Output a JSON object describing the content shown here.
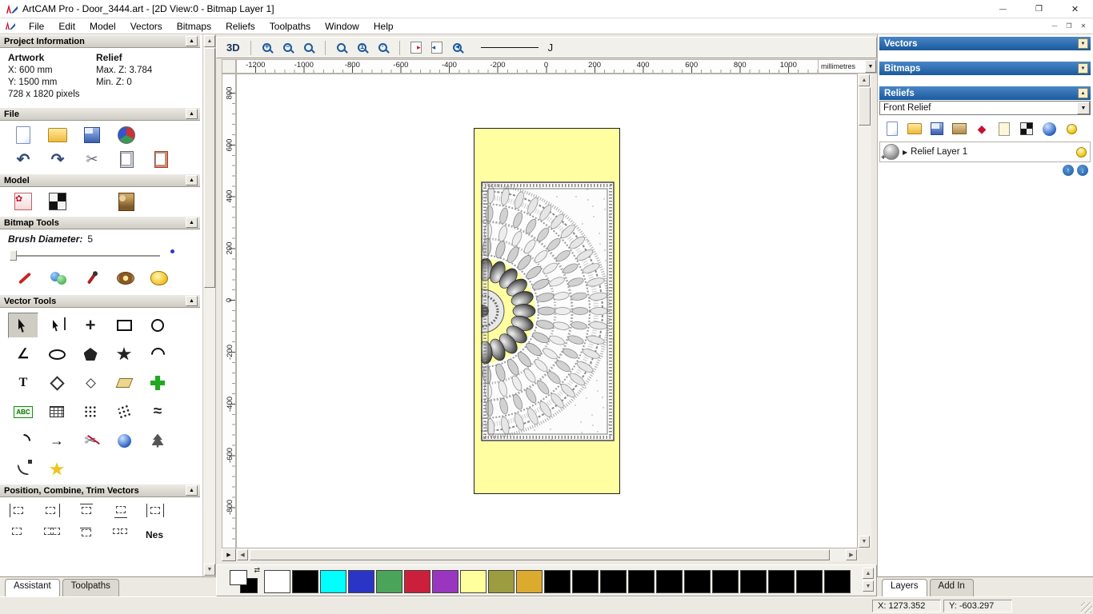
{
  "window": {
    "title": "ArtCAM Pro - Door_3444.art - [2D View:0 - Bitmap Layer 1]"
  },
  "menu": {
    "items": [
      "File",
      "Edit",
      "Model",
      "Vectors",
      "Bitmaps",
      "Reliefs",
      "Toolpaths",
      "Window",
      "Help"
    ]
  },
  "assistant": {
    "project": {
      "title": "Project Information",
      "artwork_heading": "Artwork",
      "x": "X: 600 mm",
      "y": "Y: 1500 mm",
      "pixels": "728 x 1820 pixels",
      "relief_heading": "Relief",
      "maxz": "Max. Z: 3.784",
      "minz": "Min. Z: 0"
    },
    "file_title": "File",
    "model_title": "Model",
    "bitmap_title": "Bitmap Tools",
    "brush_label": "Brush Diameter:",
    "brush_value": "5",
    "vector_title": "Vector Tools",
    "position_title": "Position, Combine, Trim Vectors",
    "tabs": [
      "Assistant",
      "Toolpaths"
    ]
  },
  "icon_text": {
    "btn3d": "3D",
    "t": "T",
    "abc": "ABC",
    "nes": "Nes",
    "j": "J"
  },
  "ruler": {
    "h": [
      "-1200",
      "-1000",
      "-800",
      "-600",
      "-400",
      "-200",
      "0",
      "200",
      "400",
      "600",
      "800",
      "1000"
    ],
    "v": [
      "800",
      "600",
      "400",
      "200",
      "0",
      "-200",
      "-400",
      "-600",
      "-800"
    ],
    "units": "millimetres"
  },
  "right": {
    "vectors": "Vectors",
    "bitmaps": "Bitmaps",
    "reliefs": "Reliefs",
    "relief_name": "Front Relief",
    "layer": "Relief Layer 1",
    "tabs": [
      "Layers",
      "Add In"
    ]
  },
  "status": {
    "x": "X: 1273.352",
    "y": "Y: -603.297"
  },
  "palette": {
    "colors": [
      "#ffffff",
      "#000000",
      "#00ffff",
      "#2a35c8",
      "#4aa45a",
      "#cc1f3c",
      "#9a35c0",
      "#ffff9c",
      "#9c9c40",
      "#dcaa2e",
      "#000000",
      "#000000",
      "#000000",
      "#000000",
      "#000000",
      "#000000",
      "#000000",
      "#000000",
      "#000000",
      "#000000",
      "#000000"
    ]
  }
}
